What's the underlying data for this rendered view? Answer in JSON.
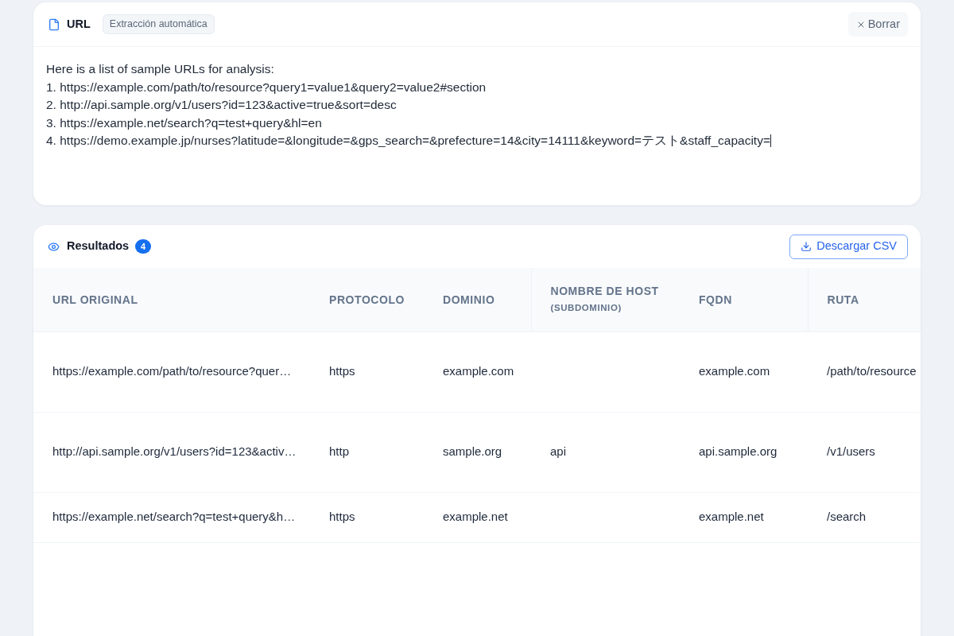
{
  "input_panel": {
    "title": "URL",
    "tag": "Extracción automática",
    "clear_button": "Borrar",
    "input": {
      "value": "Here is a list of sample URLs for analysis:\n1. https://example.com/path/to/resource?query1=value1&query2=value2#section\n2. http://api.sample.org/v1/users?id=123&active=true&sort=desc\n3. https://example.net/search?q=test+query&hl=en\n4. https://demo.example.jp/nurses?latitude=&longitude=&gps_search=&prefecture=14&city=14111&keyword=テスト&staff_capacity=",
      "focused": true
    }
  },
  "results": {
    "title": "Resultados",
    "count": "4",
    "download_button": "Descargar CSV",
    "table": {
      "columns": [
        {
          "label": "URL ORIGINAL"
        },
        {
          "label": "PROTOCOLO"
        },
        {
          "label": "DOMINIO"
        },
        {
          "label": "NOMBRE DE HOST",
          "sublabel": "(SUBDOMINIO)"
        },
        {
          "label": "FQDN"
        },
        {
          "label": "RUTA"
        }
      ],
      "rows": [
        {
          "url_original": "https://example.com/path/to/resource?quer…",
          "protocolo": "https",
          "dominio": "example.com",
          "fqdn": "example.com",
          "ruta": "/path/to/resource"
        },
        {
          "url_original": "http://api.sample.org/v1/users?id=123&activ…",
          "protocolo": "http",
          "dominio": "sample.org",
          "nombre_de_host": "api",
          "fqdn": "api.sample.org",
          "ruta": "/v1/users"
        },
        {
          "url_original": "https://example.net/search?q=test+query&h…",
          "protocolo": "https",
          "dominio": "example.net",
          "fqdn": "example.net",
          "ruta": "/search"
        }
      ]
    }
  }
}
